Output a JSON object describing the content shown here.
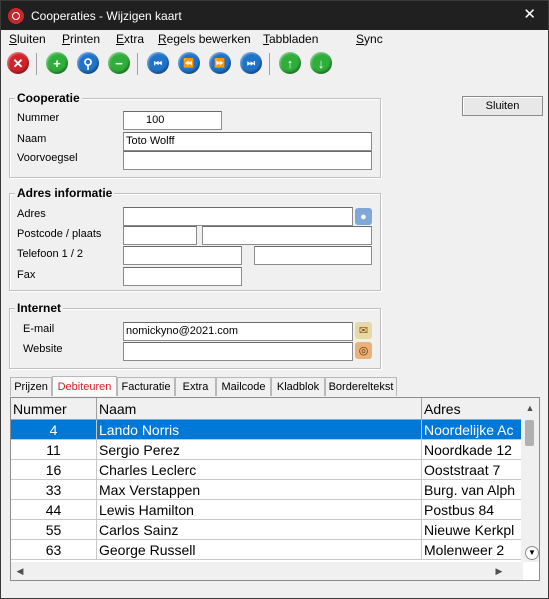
{
  "window": {
    "title": "Cooperaties - Wijzigen kaart",
    "close_glyph": "✕"
  },
  "menu": [
    "Sluiten",
    "Printen",
    "Extra",
    "Regels bewerken",
    "Tabbladen",
    "Sync"
  ],
  "toolbar": {
    "icons": [
      "delete-icon",
      "add-icon",
      "search-icon",
      "remove-icon",
      "first-record-icon",
      "previous-record-icon",
      "next-record-icon",
      "last-record-icon",
      "move-up-icon",
      "move-down-icon"
    ],
    "glyphs": {
      "delete": "✕",
      "add": "+",
      "search": "⚲",
      "remove": "−",
      "first": "⏮",
      "previous": "⏪",
      "next": "⏩",
      "last": "⏭",
      "up": "↑",
      "down": "↓"
    }
  },
  "cooperatie": {
    "legend": "Cooperatie",
    "nummer_label": "Nummer",
    "nummer_value": "100",
    "naam_label": "Naam",
    "naam_value": "Toto Wolff",
    "voorvoegsel_label": "Voorvoegsel",
    "voorvoegsel_value": ""
  },
  "adres": {
    "legend": "Adres informatie",
    "adres_label": "Adres",
    "adres_value": "",
    "postcode_label": "Postcode / plaats",
    "postcode_value": "",
    "plaats_value": "",
    "telefoon_label": "Telefoon 1 / 2",
    "telefoon1_value": "",
    "telefoon2_value": "",
    "fax_label": "Fax",
    "fax_value": ""
  },
  "internet": {
    "legend": "Internet",
    "email_label": "E-mail",
    "email_value": "nomickyno@2021.com",
    "website_label": "Website",
    "website_value": ""
  },
  "buttons": {
    "sluiten": "Sluiten"
  },
  "tabs": [
    "Prijzen",
    "Debiteuren",
    "Facturatie",
    "Extra",
    "Mailcode",
    "Kladblok",
    "Bordereltekst"
  ],
  "active_tab": "Debiteuren",
  "grid": {
    "columns": [
      "Nummer",
      "Naam",
      "Adres"
    ],
    "rows": [
      [
        "4",
        "Lando Norris",
        "Noordelijke Ac"
      ],
      [
        "11",
        "Sergio Perez",
        "Noordkade 12"
      ],
      [
        "16",
        "Charles Leclerc",
        "Ooststraat 7"
      ],
      [
        "33",
        "Max Verstappen",
        "Burg. van Alph"
      ],
      [
        "44",
        "Lewis Hamilton",
        "Postbus 84"
      ],
      [
        "55",
        "Carlos Sainz",
        "Nieuwe Kerkpl"
      ],
      [
        "63",
        "George Russell",
        "Molenweer 2"
      ]
    ],
    "selected_row": 0
  },
  "colors": {
    "selection": "#0078d7",
    "active_tab_text": "#d2232a",
    "titlebar": "#202020"
  }
}
